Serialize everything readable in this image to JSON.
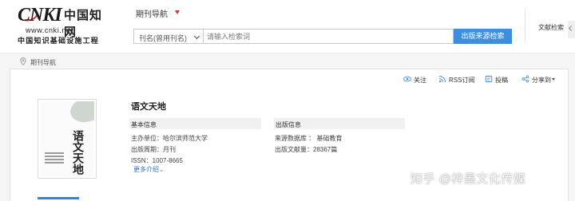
{
  "header": {
    "logo": {
      "brand": "CNKI",
      "cn_name": "中国知网",
      "url": "www.cnki.net",
      "subtitle": "中国知识基础设施工程"
    },
    "nav_title": "期刊导航",
    "search": {
      "select_value": "刊名(曾用刊名)",
      "placeholder": "请输入检索词",
      "button_label": "出版来源检索"
    },
    "advanced_search": "文献检索"
  },
  "breadcrumb": {
    "text": "期刊导航"
  },
  "actions": [
    {
      "label": "关注",
      "icon": "eye-icon"
    },
    {
      "label": "RSS订阅",
      "icon": "rss-icon"
    },
    {
      "label": "投稿",
      "icon": "submit-icon"
    },
    {
      "label": "分享到",
      "icon": "share-icon"
    }
  ],
  "journal": {
    "title": "语文天地",
    "cover_title": "语文天地",
    "basic_info": {
      "heading": "基本信息",
      "sponsor": "主办单位：哈尔滨师范大学",
      "frequency": "出版周期：月刊",
      "issn": "ISSN：1007-8665",
      "more": "更多介绍"
    },
    "publication_info": {
      "heading": "出版信息",
      "database": "来源数据库 ： 基础教育",
      "doc_count": "出版文献量：28367篇"
    }
  },
  "watermark": "知乎 @梓墨文化传媒",
  "colors": {
    "accent_blue": "#3c8fe0",
    "logo_red": "#e0302d",
    "link_blue": "#2b6fc4"
  }
}
